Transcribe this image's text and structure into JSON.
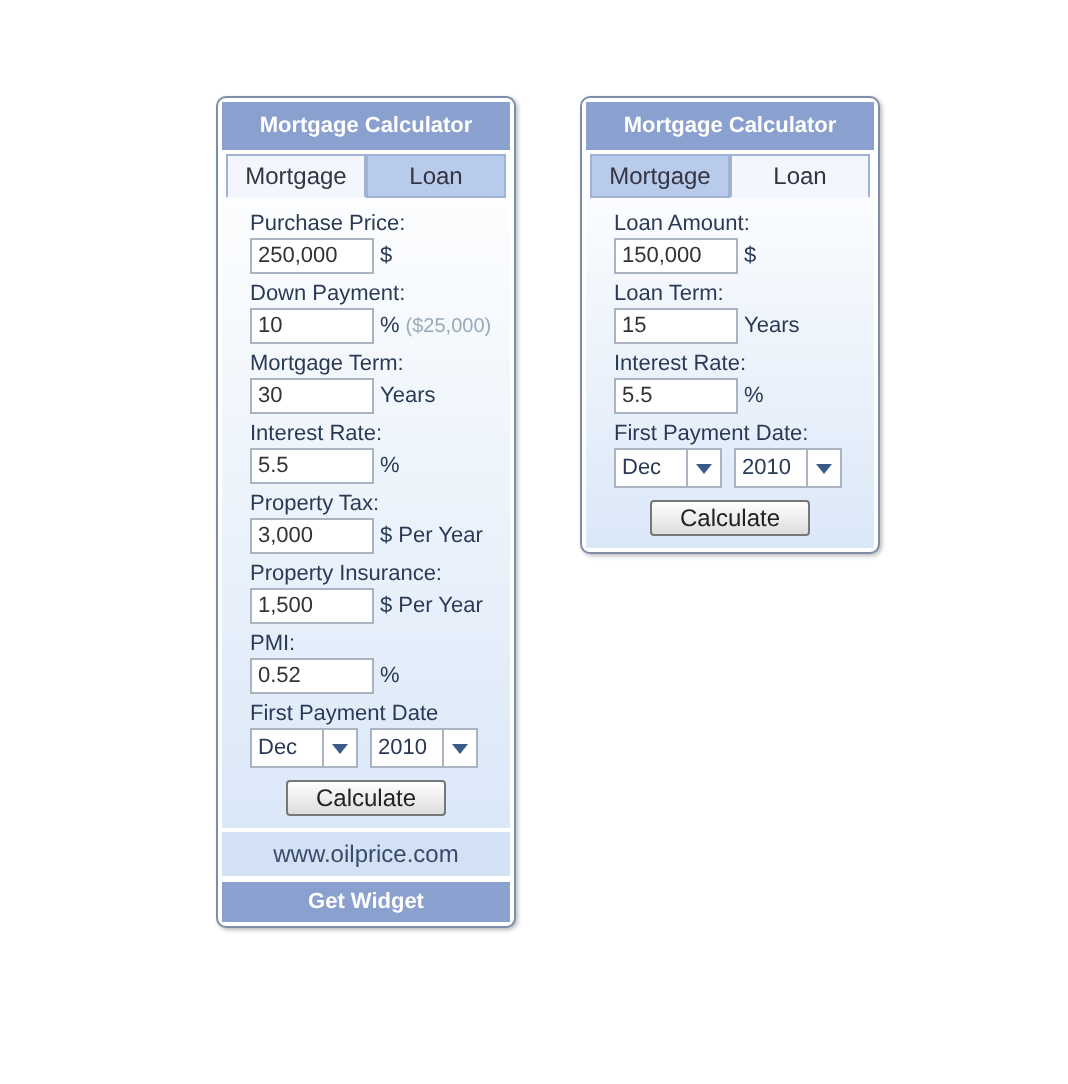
{
  "widgets": [
    {
      "title": "Mortgage Calculator",
      "tabs": [
        {
          "label": "Mortgage",
          "selected": true
        },
        {
          "label": "Loan",
          "selected": false
        }
      ],
      "fields": [
        {
          "kind": "field",
          "label": "Purchase Price:",
          "value": "250,000",
          "unit": "$"
        },
        {
          "kind": "field",
          "label": "Down Payment:",
          "value": "10",
          "unit": "%",
          "note": "($25,000)"
        },
        {
          "kind": "field",
          "label": "Mortgage Term:",
          "value": "30",
          "unit": "Years"
        },
        {
          "kind": "field",
          "label": "Interest Rate:",
          "value": "5.5",
          "unit": "%"
        },
        {
          "kind": "field",
          "label": "Property Tax:",
          "value": "3,000",
          "unit": "$ Per Year"
        },
        {
          "kind": "field",
          "label": "Property Insurance:",
          "value": "1,500",
          "unit": "$ Per Year"
        },
        {
          "kind": "field",
          "label": "PMI:",
          "value": "0.52",
          "unit": "%"
        },
        {
          "kind": "date",
          "label": "First Payment Date",
          "month": "Dec",
          "year": "2010"
        }
      ],
      "button": "Calculate",
      "link": "www.oilprice.com",
      "footer": "Get Widget"
    },
    {
      "title": "Mortgage Calculator",
      "tabs": [
        {
          "label": "Mortgage",
          "selected": false
        },
        {
          "label": "Loan",
          "selected": true
        }
      ],
      "fields": [
        {
          "kind": "field",
          "label": "Loan Amount:",
          "value": "150,000",
          "unit": "$"
        },
        {
          "kind": "field",
          "label": "Loan Term:",
          "value": "15",
          "unit": "Years"
        },
        {
          "kind": "field",
          "label": "Interest Rate:",
          "value": "5.5",
          "unit": "%"
        },
        {
          "kind": "date",
          "label": "First Payment Date:",
          "month": "Dec",
          "year": "2010"
        }
      ],
      "button": "Calculate"
    }
  ]
}
